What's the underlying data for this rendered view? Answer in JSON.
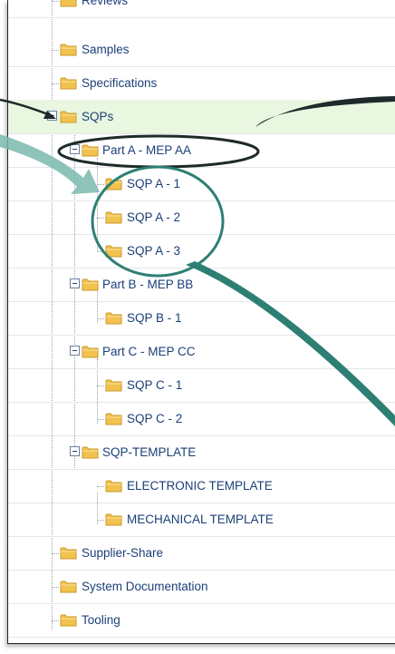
{
  "tree": {
    "reviews": "Reviews",
    "samples": "Samples",
    "specifications": "Specifications",
    "sqps": "SQPs",
    "part_a": "Part A - MEP AA",
    "sqp_a1": "SQP A - 1",
    "sqp_a2": "SQP A - 2",
    "sqp_a3": "SQP A - 3",
    "part_b": "Part B - MEP BB",
    "sqp_b1": "SQP B - 1",
    "part_c": "Part C - MEP CC",
    "sqp_c1": "SQP C - 1",
    "sqp_c2": "SQP C - 2",
    "sqp_template": "SQP-TEMPLATE",
    "electronic_template": "ELECTRONIC TEMPLATE",
    "mechanical_template": "MECHANICAL TEMPLATE",
    "supplier_share": "Supplier-Share",
    "system_documentation": "System Documentation",
    "tooling": "Tooling"
  },
  "colors": {
    "link_text": "#1b3f77",
    "highlight_row": "#e9f6e0",
    "folder": "#f2c24e",
    "annotation_teal": "#2e7f73",
    "annotation_dark": "#1e2a2a"
  },
  "icons": {
    "folder": "folder-icon",
    "collapse": "minus-box-icon"
  }
}
